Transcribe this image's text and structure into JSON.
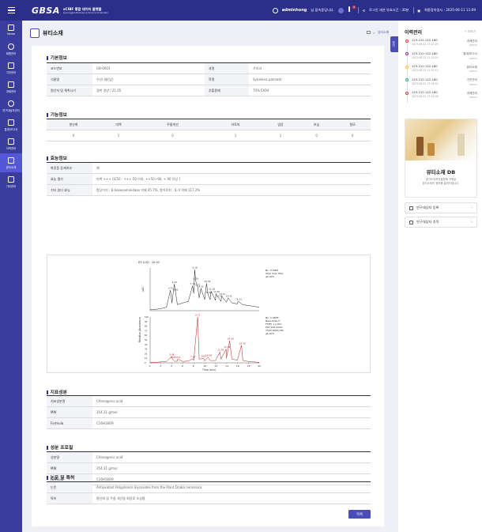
{
  "topbar": {
    "logo_main": "GBSA",
    "logo_sub1": "xCIBF 통합 데이터 플랫폼",
    "logo_sub2": "Gyeonggido Business & Science Accelerator",
    "user_name": "adminhong",
    "user_suffix": "님 접속중입니다.",
    "session_label": "로그인 세션 유효시간 : 30분",
    "last_login": "최종접속일시 : 2025-06-11 11:09",
    "notif_count": "3"
  },
  "nav": [
    {
      "label": "Home",
      "icon": "home-icon"
    },
    {
      "label": "회원관리",
      "icon": "user-icon"
    },
    {
      "label": "기관관리",
      "icon": "monitor-icon"
    },
    {
      "label": "과제관리",
      "icon": "clipboard-icon"
    },
    {
      "label": "연구대상자관리",
      "icon": "people-icon"
    },
    {
      "label": "통계/보고서",
      "icon": "chart-icon"
    },
    {
      "label": "이력관리",
      "icon": "document-icon"
    },
    {
      "label": "뷰티소재",
      "icon": "edit-icon"
    },
    {
      "label": "기타관리",
      "icon": "list-icon"
    }
  ],
  "page": {
    "title": "뷰티소재",
    "breadcrumb_last": "뷰티소재",
    "list_button": "목록",
    "collapse_label": "접기"
  },
  "basic": {
    "title": "기본정보",
    "rows": [
      [
        "코드번호",
        "GB-0001",
        "과명",
        "가지과"
      ],
      [
        "식물명",
        "우산나물(잎)",
        "학명",
        "Synelesis palmata"
      ],
      [
        "원산지 및 채취시기",
        "경북 영양 / 21.05",
        "추출용매",
        "70% EtOH"
      ]
    ]
  },
  "function": {
    "title": "기능정보",
    "headers": [
      "항산화",
      "미백",
      "주름개선",
      "아토피",
      "염증",
      "보습",
      "탈모"
    ],
    "values": [
      "0",
      "1",
      "0",
      "1",
      "1",
      "0",
      "0"
    ]
  },
  "efficacy": {
    "title": "효능정보",
    "rows": [
      [
        "화장품 등재여부",
        "예"
      ],
      [
        "효능 평가",
        "미백 +++ [IC50 : +++ 50 이하, ++50~90, + 90 이상 ]"
      ],
      [
        "기타 뷰티 효능",
        "항당이치 : β-hexosaminidase 억제 45.7%, 항아토피 : IL-4 억제 117.2%"
      ]
    ]
  },
  "chart_data": {
    "type": "line",
    "top_header": "RT: 0.00 - 20.00",
    "top_info": [
      "NL: 9.30E4",
      "Total Scan PDA",
      "gb-025"
    ],
    "top_peaks": [
      "8.18",
      "7.78",
      "8.34",
      "3.73",
      "10.34",
      "4.43",
      "8.72",
      "9.32",
      "4.65",
      "11.18",
      "10.62",
      "12.05",
      "12.55",
      "13.11",
      "14.31",
      "16.11"
    ],
    "bottom_info": [
      "NL: 2.34E8",
      "Base Peak F:",
      "FTMS + p ESI",
      "MS [100.0000-",
      "1500.0000] MS",
      "gb-025"
    ],
    "bottom_peaks": [
      "8.72",
      "14.59",
      "16.76",
      "13.95",
      "3.96",
      "12.78",
      "10.59",
      "4.11",
      "9.82",
      "5.04",
      "7.87"
    ],
    "ylabel_top": "uAU",
    "ylabel_bottom": "Relative Abundance",
    "xlabel": "Time (min)",
    "x_ticks": [
      "0",
      "2",
      "4",
      "6",
      "8",
      "10",
      "12",
      "14",
      "16",
      "18",
      "20"
    ],
    "y_ticks_bottom": [
      "0",
      "10",
      "20",
      "30",
      "40",
      "50",
      "60",
      "70",
      "80",
      "90",
      "100"
    ],
    "xlim": [
      0,
      20
    ],
    "series": [
      {
        "name": "PDA",
        "x": [
          0,
          1,
          2,
          3,
          3.73,
          4,
          4.43,
          4.65,
          5,
          6,
          7,
          7.78,
          8,
          8.18,
          8.34,
          8.72,
          9,
          9.32,
          10,
          10.34,
          10.62,
          11,
          11.18,
          12,
          12.05,
          12.55,
          13,
          13.11,
          14,
          14.31,
          15,
          16,
          16.11,
          17,
          18,
          19,
          20
        ],
        "y": [
          2,
          3,
          5,
          8,
          48,
          18,
          62,
          44,
          14,
          18,
          22,
          58,
          40,
          96,
          70,
          56,
          30,
          52,
          26,
          64,
          38,
          26,
          46,
          24,
          40,
          30,
          22,
          34,
          20,
          30,
          18,
          16,
          22,
          14,
          12,
          10,
          8
        ]
      },
      {
        "name": "Base Peak",
        "x": [
          0,
          1,
          2,
          3,
          3.96,
          4.11,
          4.5,
          5,
          5.04,
          6,
          7,
          7.87,
          8,
          8.72,
          9,
          9.82,
          10,
          10.59,
          11,
          12,
          12.78,
          13,
          13.95,
          14,
          14.59,
          15,
          16,
          16.76,
          17,
          18,
          19,
          20
        ],
        "y": [
          1,
          1,
          2,
          3,
          14,
          8,
          3,
          4,
          8,
          3,
          4,
          9,
          5,
          100,
          8,
          10,
          4,
          12,
          5,
          5,
          24,
          8,
          30,
          10,
          48,
          8,
          6,
          38,
          5,
          3,
          2,
          1
        ]
      }
    ]
  },
  "index": {
    "title": "지표성분",
    "rows": [
      [
        "지표성분명",
        "Chlorogenic acid"
      ],
      [
        "MW",
        "354.31 g/mol"
      ],
      [
        "Formula",
        "C16H18O9"
      ]
    ]
  },
  "component": {
    "title": "성분 프로필",
    "rows": [
      [
        "성분명",
        "Chlorogenic acid"
      ],
      [
        "MW",
        "354.31 g/mol"
      ],
      [
        "Formula",
        "C16H18O9"
      ]
    ]
  },
  "paper": {
    "title": "논문 및 특허",
    "rows": [
      [
        "논문",
        "Antioxidant Polyphenol Glycosides from the Plant Draba nemorosa"
      ],
      [
        "특허",
        "항산화 및 주름 개선용 화장료 조성물"
      ]
    ]
  },
  "history": {
    "title": "이력관리",
    "more": "+ 더보기",
    "items": [
      {
        "ip": "123.212.112.180",
        "date": "2023.08.22 17:15:29",
        "menu": "과제관리",
        "user": "admin",
        "color": "#e53935"
      },
      {
        "ip": "123.212.112.180",
        "date": "2023.08.22 17:15:20",
        "menu": "통계/보고서",
        "user": "admin",
        "color": "#8e24aa"
      },
      {
        "ip": "123.212.112.180",
        "date": "2023.08.22 17:15:13",
        "menu": "뷰티소재",
        "user": "admin",
        "color": "#fbc02d"
      },
      {
        "ip": "123.212.112.180",
        "date": "2023.08.22 17:14:30",
        "menu": "기관관리",
        "user": "admin",
        "color": "#26a69a"
      },
      {
        "ip": "123.212.112.180",
        "date": "2023.08.22 17:14:08",
        "menu": "과제관리",
        "user": "admin",
        "color": "#e53935"
      }
    ]
  },
  "banner": {
    "title": "뷰티소재 DB",
    "desc1": "경기도과학진흥원에 구축된",
    "desc2": "뷰티소재의 정보를 알려드립니다."
  },
  "links": [
    {
      "label": "연구대상자 등록"
    },
    {
      "label": "연구대상자 추적"
    }
  ]
}
